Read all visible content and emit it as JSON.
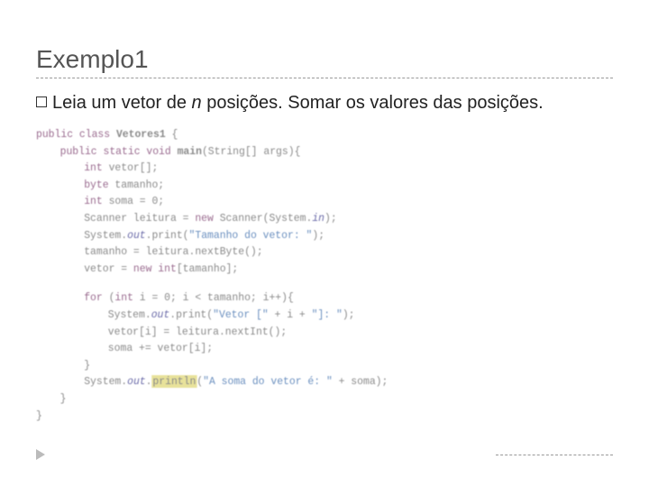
{
  "title": "Exemplo1",
  "desc_prefix": "Leia um vetor de ",
  "desc_n": "n",
  "desc_suffix": " posições.  Somar os valores das posições.",
  "code": {
    "l01a": "public class ",
    "l01b": "Vetores1",
    "l01c": " {",
    "l02a": "public static void ",
    "l02b": "main",
    "l02c": "(String[] args){",
    "l03": "int vetor[];",
    "l04": "byte tamanho;",
    "l05": "int soma = 0;",
    "l06a": "Scanner leitura = ",
    "l06b": "new",
    "l06c": " Scanner(System.",
    "l06d": "in",
    "l06e": ");",
    "l07a": "System.",
    "l07b": "out",
    "l07c": ".print(",
    "l07d": "\"Tamanho do vetor: \"",
    "l07e": ");",
    "l08": "tamanho = leitura.nextByte();",
    "l09a": "vetor = ",
    "l09b": "new int",
    "l09c": "[tamanho];",
    "l10a": "for",
    "l10b": " (",
    "l10c": "int",
    "l10d": " i = 0; i < tamanho; i++){",
    "l11a": "System.",
    "l11b": "out",
    "l11c": ".print(",
    "l11d": "\"Vetor [\"",
    "l11e": " + i + ",
    "l11f": "\"]: \"",
    "l11g": ");",
    "l12": "vetor[i] = leitura.nextInt();",
    "l13": "soma += vetor[i];",
    "l14": "}",
    "l15a": "System.",
    "l15b": "out",
    "l15c": ".",
    "l15d": "println",
    "l15e": "(",
    "l15f": "\"A soma do vetor é: \"",
    "l15g": " + soma);",
    "l16": "}",
    "l17": "}"
  }
}
